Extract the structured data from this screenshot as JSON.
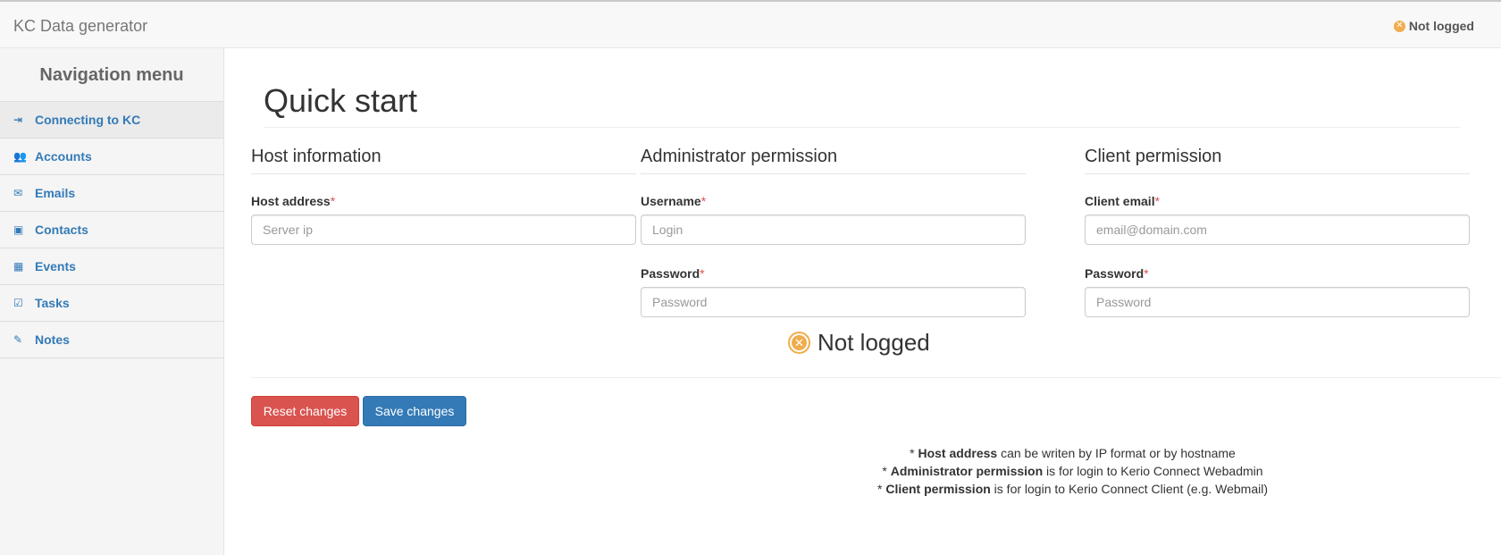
{
  "header": {
    "brand": "KC Data generator",
    "status": "Not logged"
  },
  "sidebar": {
    "title": "Navigation menu",
    "items": [
      {
        "label": "Connecting to KC",
        "icon": "sign-in-icon",
        "glyph": "⇥",
        "active": true
      },
      {
        "label": "Accounts",
        "icon": "users-icon",
        "glyph": "👥",
        "active": false
      },
      {
        "label": "Emails",
        "icon": "envelope-icon",
        "glyph": "✉",
        "active": false
      },
      {
        "label": "Contacts",
        "icon": "address-book-icon",
        "glyph": "▣",
        "active": false
      },
      {
        "label": "Events",
        "icon": "calendar-icon",
        "glyph": "▦",
        "active": false
      },
      {
        "label": "Tasks",
        "icon": "check-square-icon",
        "glyph": "☑",
        "active": false
      },
      {
        "label": "Notes",
        "icon": "edit-icon",
        "glyph": "✎",
        "active": false
      }
    ]
  },
  "main": {
    "title": "Quick start",
    "host": {
      "heading": "Host information",
      "address_label": "Host address",
      "address_placeholder": "Server ip"
    },
    "admin": {
      "heading": "Administrator permission",
      "username_label": "Username",
      "username_placeholder": "Login",
      "password_label": "Password",
      "password_placeholder": "Password"
    },
    "client": {
      "heading": "Client permission",
      "email_label": "Client email",
      "email_placeholder": "email@domain.com",
      "password_label": "Password",
      "password_placeholder": "Password"
    },
    "required_mark": "*",
    "login_status": "Not logged",
    "reset_label": "Reset changes",
    "save_label": "Save changes",
    "notes": [
      {
        "prefix": "* ",
        "bold": "Host address",
        "text": " can be writen by IP format or by hostname"
      },
      {
        "prefix": "* ",
        "bold": "Administrator permission",
        "text": " is for login to Kerio Connect Webadmin"
      },
      {
        "prefix": "* ",
        "bold": "Client permission",
        "text": " is for login to Kerio Connect Client (e.g. Webmail)"
      }
    ]
  },
  "colors": {
    "primary": "#337ab7",
    "danger": "#d9534f",
    "warning": "#f0ad4e"
  }
}
